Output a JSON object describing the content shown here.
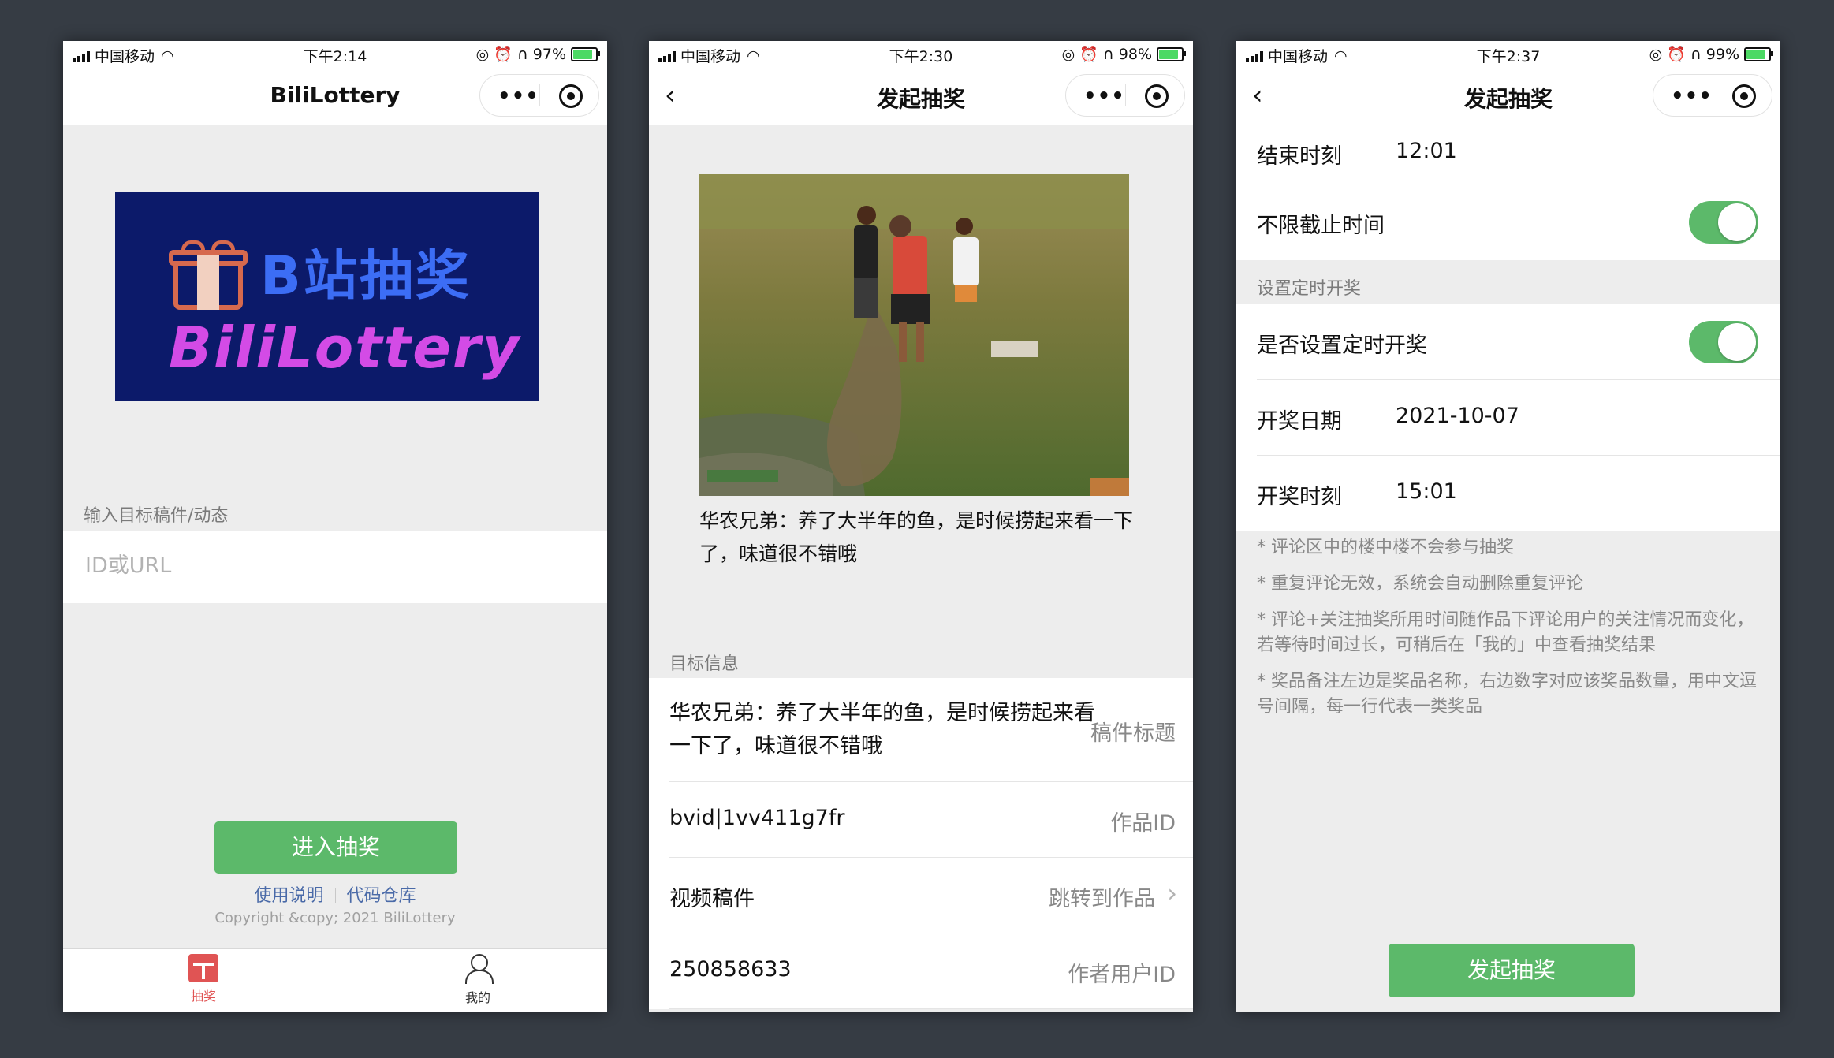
{
  "phones": [
    {
      "status": {
        "carrier": "中国移动",
        "time": "下午2:14",
        "battery": "97%"
      },
      "nav": {
        "title": "BiliLottery"
      },
      "banner": {
        "zh": "B站抽奖",
        "en": "BiliLottery"
      },
      "input_label": "输入目标稿件/动态",
      "input_placeholder": "ID或URL",
      "enter_button": "进入抽奖",
      "links": [
        "使用说明",
        "代码仓库"
      ],
      "copyright": "Copyright &copy; 2021 BiliLottery",
      "tabs": [
        {
          "label": "抽奖",
          "icon": "gift-icon",
          "active": true
        },
        {
          "label": "我的",
          "icon": "user-icon",
          "active": false
        }
      ]
    },
    {
      "status": {
        "carrier": "中国移动",
        "time": "下午2:30",
        "battery": "98%"
      },
      "nav": {
        "title": "发起抽奖"
      },
      "caption": "华农兄弟：养了大半年的鱼，是时候捞起来看一下了，味道很不错哦",
      "section_label": "目标信息",
      "rows": [
        {
          "left": "华农兄弟：养了大半年的鱼，是时候捞起来看一下了，味道很不错哦",
          "right": "稿件标题"
        },
        {
          "left": "bvid|1vv411g7fr",
          "right": "作品ID"
        },
        {
          "left": "视频稿件",
          "right": "跳转到作品"
        },
        {
          "left": "250858633",
          "right": "作者用户ID"
        }
      ]
    },
    {
      "status": {
        "carrier": "中国移动",
        "time": "下午2:37",
        "battery": "99%"
      },
      "nav": {
        "title": "发起抽奖"
      },
      "end_time": {
        "label": "结束时刻",
        "value": "12:01"
      },
      "no_deadline": {
        "label": "不限截止时间",
        "on": true
      },
      "section_label": "设置定时开奖",
      "timed_draw": {
        "label": "是否设置定时开奖",
        "on": true
      },
      "draw_date": {
        "label": "开奖日期",
        "value": "2021-10-07"
      },
      "draw_time": {
        "label": "开奖时刻",
        "value": "15:01"
      },
      "notes": [
        "* 评论区中的楼中楼不会参与抽奖",
        "* 重复评论无效，系统会自动删除重复评论",
        "* 评论+关注抽奖所用时间随作品下评论用户的关注情况而变化，若等待时间过长，可稍后在「我的」中查看抽奖结果",
        "* 奖品备注左边是奖品名称，右边数字对应该奖品数量，用中文逗号间隔，每一行代表一类奖品"
      ],
      "launch_button": "发起抽奖"
    }
  ],
  "colors": {
    "accent_green": "#5cb96a",
    "banner_bg": "#0c1a6a",
    "link": "#4a6aa8"
  }
}
